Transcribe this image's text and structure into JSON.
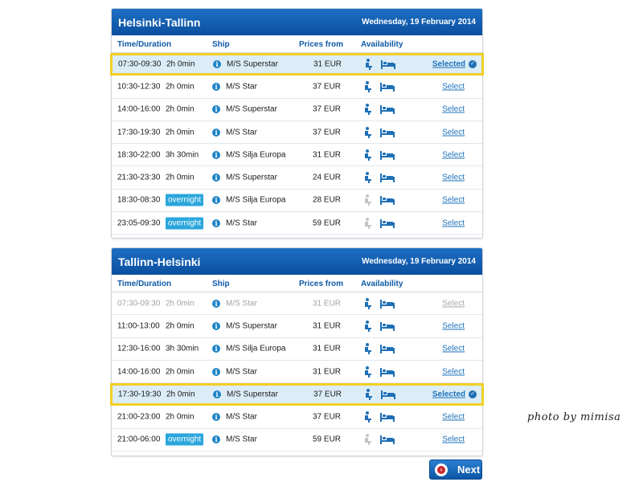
{
  "outbound": {
    "title": "Helsinki-Tallinn",
    "date": "Wednesday, 19 February 2014",
    "columns": {
      "time": "Time/Duration",
      "ship": "Ship",
      "price": "Prices from",
      "availability": "Availability"
    },
    "rows": [
      {
        "time": "07:30-09:30",
        "duration": "2h 0min",
        "ship": "M/S Superstar",
        "price": "31 EUR",
        "link": "Selected"
      },
      {
        "time": "10:30-12:30",
        "duration": "2h 0min",
        "ship": "M/S Star",
        "price": "37 EUR",
        "link": "Select"
      },
      {
        "time": "14:00-16:00",
        "duration": "2h 0min",
        "ship": "M/S Superstar",
        "price": "37 EUR",
        "link": "Select"
      },
      {
        "time": "17:30-19:30",
        "duration": "2h 0min",
        "ship": "M/S Star",
        "price": "37 EUR",
        "link": "Select"
      },
      {
        "time": "18:30-22:00",
        "duration": "3h 30min",
        "ship": "M/S Silja Europa",
        "price": "31 EUR",
        "link": "Select"
      },
      {
        "time": "21:30-23:30",
        "duration": "2h 0min",
        "ship": "M/S Superstar",
        "price": "24 EUR",
        "link": "Select"
      },
      {
        "time": "18:30-08:30",
        "duration": "overnight",
        "ship": "M/S Silja Europa",
        "price": "28 EUR",
        "link": "Select"
      },
      {
        "time": "23:05-09:30",
        "duration": "overnight",
        "ship": "M/S Star",
        "price": "59 EUR",
        "link": "Select"
      }
    ]
  },
  "return": {
    "title": "Tallinn-Helsinki",
    "date": "Wednesday, 19 February 2014",
    "columns": {
      "time": "Time/Duration",
      "ship": "Ship",
      "price": "Prices from",
      "availability": "Availability"
    },
    "rows": [
      {
        "time": "07:30-09:30",
        "duration": "2h 0min",
        "ship": "M/S Star",
        "price": "31 EUR",
        "link": "Select"
      },
      {
        "time": "11:00-13:00",
        "duration": "2h 0min",
        "ship": "M/S Superstar",
        "price": "31 EUR",
        "link": "Select"
      },
      {
        "time": "12:30-16:00",
        "duration": "3h 30min",
        "ship": "M/S Silja Europa",
        "price": "31 EUR",
        "link": "Select"
      },
      {
        "time": "14:00-16:00",
        "duration": "2h 0min",
        "ship": "M/S Star",
        "price": "31 EUR",
        "link": "Select"
      },
      {
        "time": "17:30-19:30",
        "duration": "2h 0min",
        "ship": "M/S Superstar",
        "price": "37 EUR",
        "link": "Selected"
      },
      {
        "time": "21:00-23:00",
        "duration": "2h 0min",
        "ship": "M/S Star",
        "price": "37 EUR",
        "link": "Select"
      },
      {
        "time": "21:00-06:00",
        "duration": "overnight",
        "ship": "M/S Star",
        "price": "59 EUR",
        "link": "Select"
      }
    ]
  },
  "next_button": {
    "label": "Next"
  },
  "watermark": "photo by mimisa",
  "colors": {
    "header_blue": "#0b4f9e",
    "selected_border": "#f2cf25",
    "selected_bg": "#dcedf7",
    "overnight_badge": "#2aa6dc",
    "link": "#2173bb"
  }
}
